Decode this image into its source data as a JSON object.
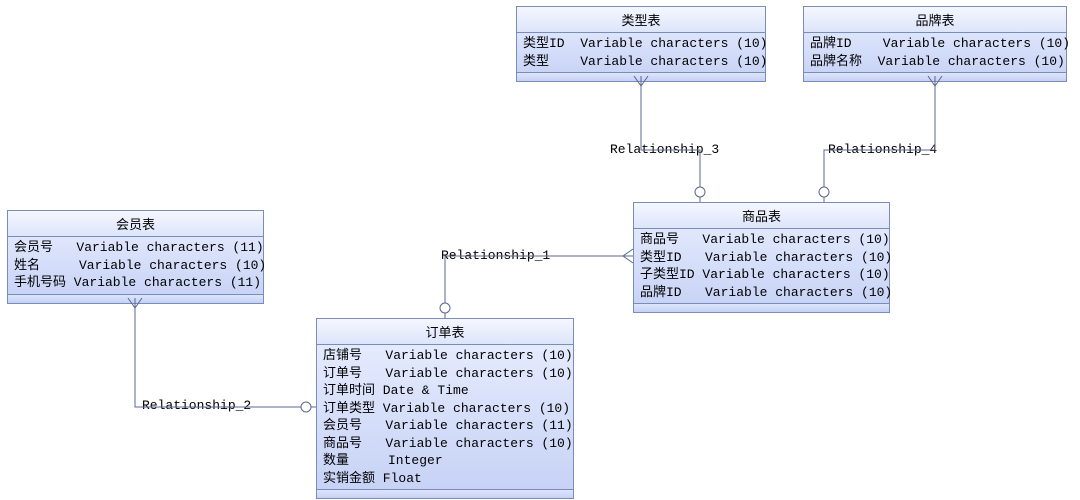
{
  "entities": {
    "member": {
      "title": "会员表",
      "rows": [
        "会员号   Variable characters (11)",
        "姓名     Variable characters (10)",
        "手机号码 Variable characters (11)"
      ]
    },
    "order": {
      "title": "订单表",
      "rows": [
        "店铺号   Variable characters (10)",
        "订单号   Variable characters (10)",
        "订单时间 Date & Time",
        "订单类型 Variable characters (10)",
        "会员号   Variable characters (11)",
        "商品号   Variable characters (10)",
        "数量     Integer",
        "实销金额 Float"
      ]
    },
    "type": {
      "title": "类型表",
      "rows": [
        "类型ID  Variable characters (10)",
        "类型    Variable characters (10)"
      ]
    },
    "brand": {
      "title": "品牌表",
      "rows": [
        "品牌ID    Variable characters (10)",
        "品牌名称  Variable characters (10)"
      ]
    },
    "product": {
      "title": "商品表",
      "rows": [
        "商品号   Variable characters (10)",
        "类型ID   Variable characters (10)",
        "子类型ID Variable characters (10)",
        "品牌ID   Variable characters (10)"
      ]
    }
  },
  "relationships": {
    "r1": "Relationship_1",
    "r2": "Relationship_2",
    "r3": "Relationship_3",
    "r4": "Relationship_4"
  }
}
